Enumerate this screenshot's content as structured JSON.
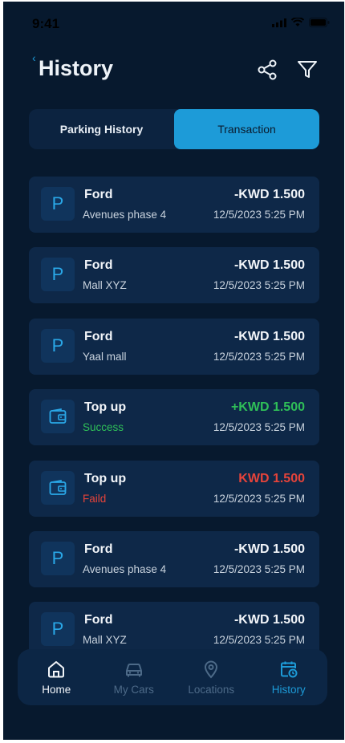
{
  "status": {
    "time": "9:41"
  },
  "header": {
    "title": "History"
  },
  "tabs": [
    {
      "label": "Parking History",
      "active": false
    },
    {
      "label": "Transaction",
      "active": true
    }
  ],
  "transactions": [
    {
      "type": "parking",
      "icon": "parking-icon",
      "title": "Ford",
      "subtitle": "Avenues phase 4",
      "amount": "-KWD 1.500",
      "date": "12/5/2023 5:25 PM"
    },
    {
      "type": "parking",
      "icon": "parking-icon",
      "title": "Ford",
      "subtitle": "Mall XYZ",
      "amount": "-KWD 1.500",
      "date": "12/5/2023 5:25 PM"
    },
    {
      "type": "parking",
      "icon": "parking-icon",
      "title": "Ford",
      "subtitle": "Yaal mall",
      "amount": "-KWD 1.500",
      "date": "12/5/2023 5:25 PM"
    },
    {
      "type": "topup-success",
      "icon": "wallet-icon",
      "title": "Top up",
      "subtitle": "Success",
      "amount": "+KWD 1.500",
      "date": "12/5/2023 5:25 PM"
    },
    {
      "type": "topup-fail",
      "icon": "wallet-icon",
      "title": "Top up",
      "subtitle": "Faild",
      "amount": "KWD 1.500",
      "date": "12/5/2023 5:25 PM"
    },
    {
      "type": "parking",
      "icon": "parking-icon",
      "title": "Ford",
      "subtitle": "Avenues phase 4",
      "amount": "-KWD 1.500",
      "date": "12/5/2023 5:25 PM"
    },
    {
      "type": "parking",
      "icon": "parking-icon",
      "title": "Ford",
      "subtitle": "Mall XYZ",
      "amount": "-KWD 1.500",
      "date": "12/5/2023 5:25 PM"
    }
  ],
  "nav": [
    {
      "label": "Home",
      "icon": "home-icon"
    },
    {
      "label": "My Cars",
      "icon": "car-icon"
    },
    {
      "label": "Locations",
      "icon": "location-pin-icon"
    },
    {
      "label": "History",
      "icon": "calendar-clock-icon"
    }
  ],
  "colors": {
    "background": "#07192e",
    "accent": "#1d9bd8",
    "success": "#2fbf58",
    "danger": "#e5433a",
    "card": "#0e2848"
  }
}
